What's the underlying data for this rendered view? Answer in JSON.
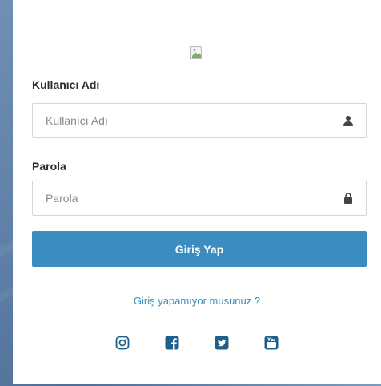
{
  "login": {
    "logo_alt": "",
    "username": {
      "label": "Kullanıcı Adı",
      "placeholder": "Kullanıcı Adı",
      "value": "",
      "icon": "user-icon"
    },
    "password": {
      "label": "Parola",
      "placeholder": "Parola",
      "value": "",
      "icon": "lock-icon"
    },
    "submit_label": "Giriş Yap",
    "help_link": "Giriş yapamıyor musunuz ?",
    "social_icons": [
      "instagram-icon",
      "facebook-icon",
      "twitter-icon",
      "youtube-icon"
    ]
  },
  "colors": {
    "accent": "#3a8cc1",
    "icon": "#1f5f8b",
    "label": "#2b2b2b"
  }
}
